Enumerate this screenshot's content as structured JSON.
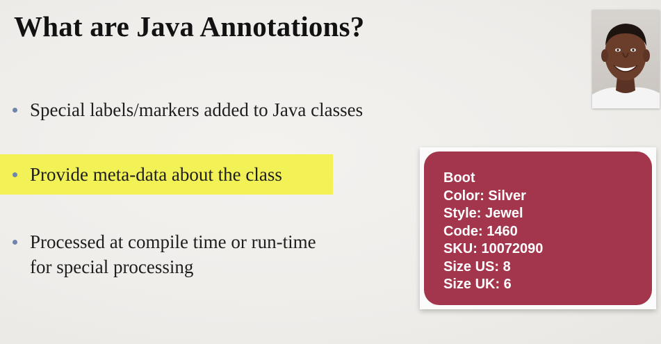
{
  "slide": {
    "title": "What are Java Annotations?",
    "bullets": [
      {
        "text": "Special labels/markers added to Java classes",
        "highlighted": false
      },
      {
        "text": "Provide meta-data about the class",
        "highlighted": true
      },
      {
        "text": "Processed at compile time or run-time for special processing",
        "highlighted": false
      }
    ],
    "highlight_color": "#f2f257",
    "bullet_color": "#6f86a8"
  },
  "label_card": {
    "background_color": "#a3364c",
    "lines": [
      "Boot",
      "Color: Silver",
      "Style: Jewel",
      "Code: 1460",
      "SKU: 10072090",
      "Size US: 8",
      "Size UK: 6"
    ]
  },
  "presenter": {
    "image": "presenter-photo"
  }
}
